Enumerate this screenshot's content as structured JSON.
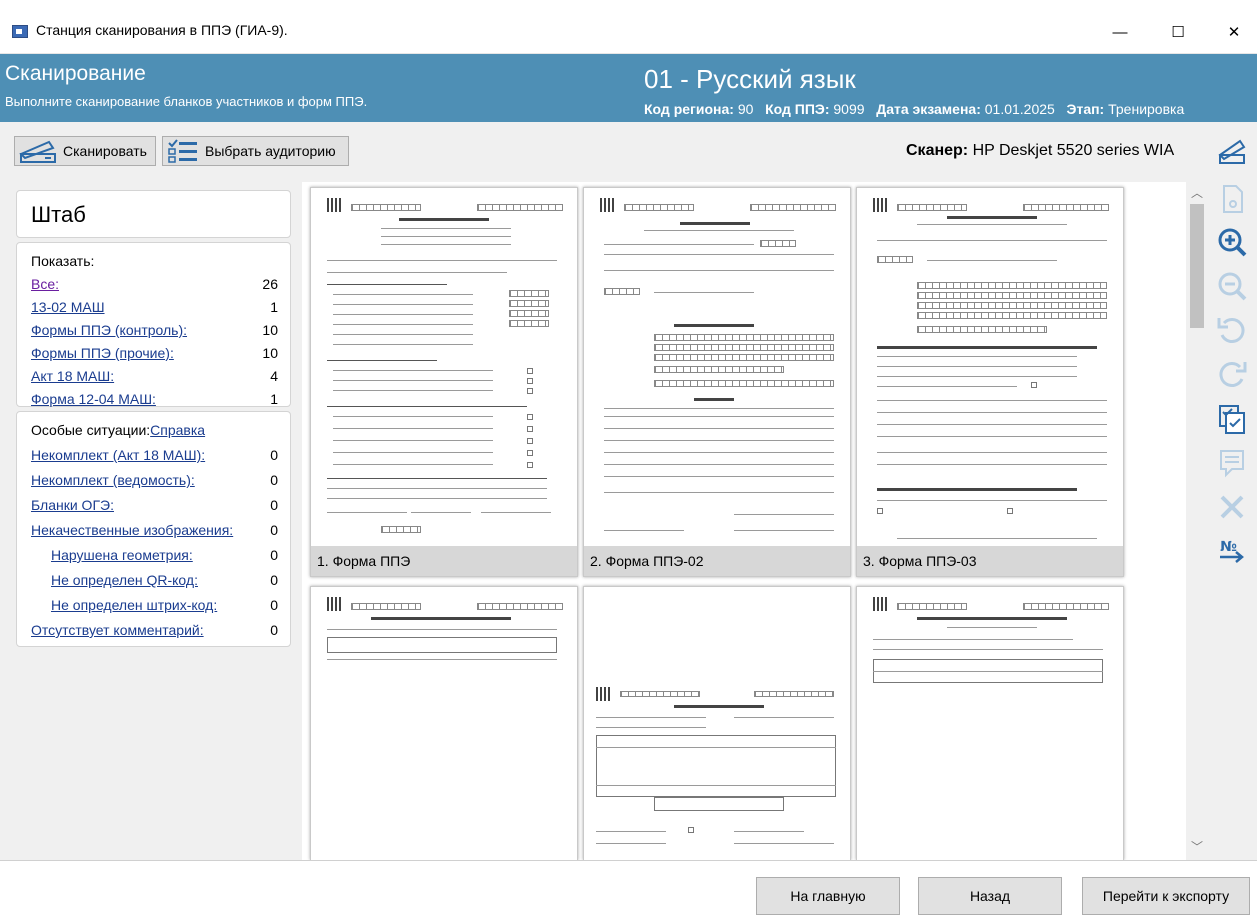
{
  "window": {
    "title": "Станция сканирования в ППЭ (ГИА-9).",
    "minimize": "—",
    "maximize": "☐",
    "close": "✕"
  },
  "header": {
    "title": "Сканирование",
    "subtitle": "Выполните сканирование бланков участников и форм ППЭ.",
    "subject": "01 - Русский язык",
    "meta": [
      {
        "label": "Код региона:",
        "value": "90"
      },
      {
        "label": "Код ППЭ:",
        "value": "9099"
      },
      {
        "label": "Дата экзамена:",
        "value": "01.01.2025"
      },
      {
        "label": "Этап:",
        "value": "Тренировка"
      }
    ]
  },
  "toolbar": {
    "scan_label": "Сканировать",
    "choose_room_label": "Выбрать аудиторию",
    "scanner_label": "Сканер:",
    "scanner_value": "HP Deskjet 5520 series WIA"
  },
  "left": {
    "headquarters": "Штаб",
    "show_label": "Показать:",
    "filters": [
      {
        "label": "Все:",
        "count": "26"
      },
      {
        "label": "13-02 МАШ",
        "count": "1"
      },
      {
        "label": "Формы ППЭ (контроль):",
        "count": "10"
      },
      {
        "label": "Формы ППЭ (прочие):",
        "count": "10"
      },
      {
        "label": "Акт 18 МАШ:",
        "count": "4"
      },
      {
        "label": "Форма 12-04 МАШ:",
        "count": "1"
      }
    ],
    "special_label": "Особые ситуации:",
    "help_link": "Справка",
    "special": [
      {
        "label": "Некомплект (Акт 18 МАШ):",
        "count": "0"
      },
      {
        "label": "Некомплект (ведомость):",
        "count": "0"
      },
      {
        "label": "Бланки ОГЭ:",
        "count": "0"
      },
      {
        "label": "Некачественные изображения:",
        "count": "0"
      },
      {
        "label": "Нарушена геометрия:",
        "count": "0"
      },
      {
        "label": "Не определен QR-код:",
        "count": "0"
      },
      {
        "label": "Не определен штрих-код:",
        "count": "0"
      },
      {
        "label": "Отсутствует комментарий:",
        "count": "0"
      }
    ]
  },
  "gallery": {
    "items": [
      {
        "caption": "1. Форма ППЭ"
      },
      {
        "caption": "2. Форма ППЭ-02"
      },
      {
        "caption": "3. Форма ППЭ-03"
      },
      {
        "caption": ""
      },
      {
        "caption": ""
      },
      {
        "caption": ""
      }
    ],
    "doc_titles": {
      "t1": "Акт готовности ППЭ",
      "t2": "АПЕЛЛЯЦИЯ",
      "t3": "ПРОТОКОЛ РАССМОТРЕНИЯ",
      "t4": "Список участников ГИА-9 в аудитории ППЭ",
      "t5": "Протокол проведения ГИА-9 в аудитории",
      "t6": "Список участников ГИА-9 в образовательной организации"
    }
  },
  "right_tools": [
    "scanner-icon",
    "preview-icon",
    "zoom-in-icon",
    "zoom-out-icon",
    "rotate-left-icon",
    "rotate-right-icon",
    "check-pages-icon",
    "comment-icon",
    "delete-icon",
    "number-icon"
  ],
  "bottom": {
    "home": "На главную",
    "back": "Назад",
    "export": "Перейти к экспорту"
  }
}
